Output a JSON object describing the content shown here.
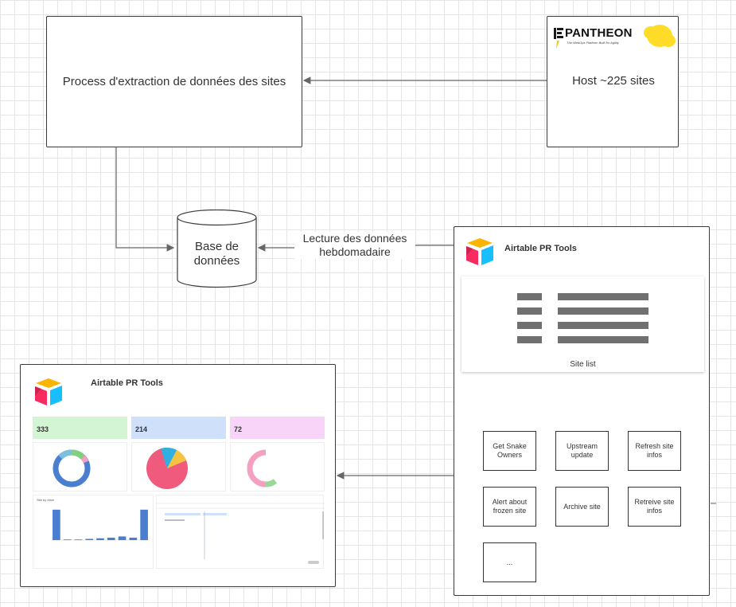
{
  "nodes": {
    "process": "Process d'extraction de données des sites",
    "host": "Host ~225 sites",
    "database_line1": "Base de",
    "database_line2": "données",
    "edge_label_line1": "Lecture des données",
    "edge_label_line2": "hebdomadaire"
  },
  "pantheon": {
    "wordmark": "PANTHEON",
    "tagline": "The WebOps Platform Built for Agility"
  },
  "airtable_tools": {
    "title": "Airtable PR Tools",
    "site_list_label": "Site list",
    "actions": [
      "Get Snake Owners",
      "Upstream update",
      "Refresh site infos",
      "Alert about frozen site",
      "Archive site",
      "Retreive site infos",
      "..."
    ]
  },
  "dashboard": {
    "title": "Airtable PR Tools",
    "stats": [
      {
        "value": "333",
        "color": "#d4f5d4"
      },
      {
        "value": "214",
        "color": "#cfe0fa"
      },
      {
        "value": "72",
        "color": "#f8d4f8"
      }
    ],
    "bar_panel_title": "Site by drive"
  },
  "colors": {
    "stroke": "#3a3a3a",
    "arrow": "#666666",
    "grid": "#e6e6e6",
    "pantheon_yellow": "#ffdc28",
    "airtable_yellow": "#fcb400",
    "airtable_red": "#f82b60",
    "airtable_blue": "#18bfff",
    "airtable_navy": "#2d7ff9",
    "bar_blue": "#4a7fd0"
  },
  "chart_data": {
    "type": "bar",
    "categories": [
      "",
      "",
      "",
      "",
      "",
      "",
      "",
      "",
      ""
    ],
    "values": [
      100,
      2,
      2,
      4,
      6,
      8,
      12,
      8,
      100
    ],
    "ylim": [
      0,
      110
    ]
  }
}
